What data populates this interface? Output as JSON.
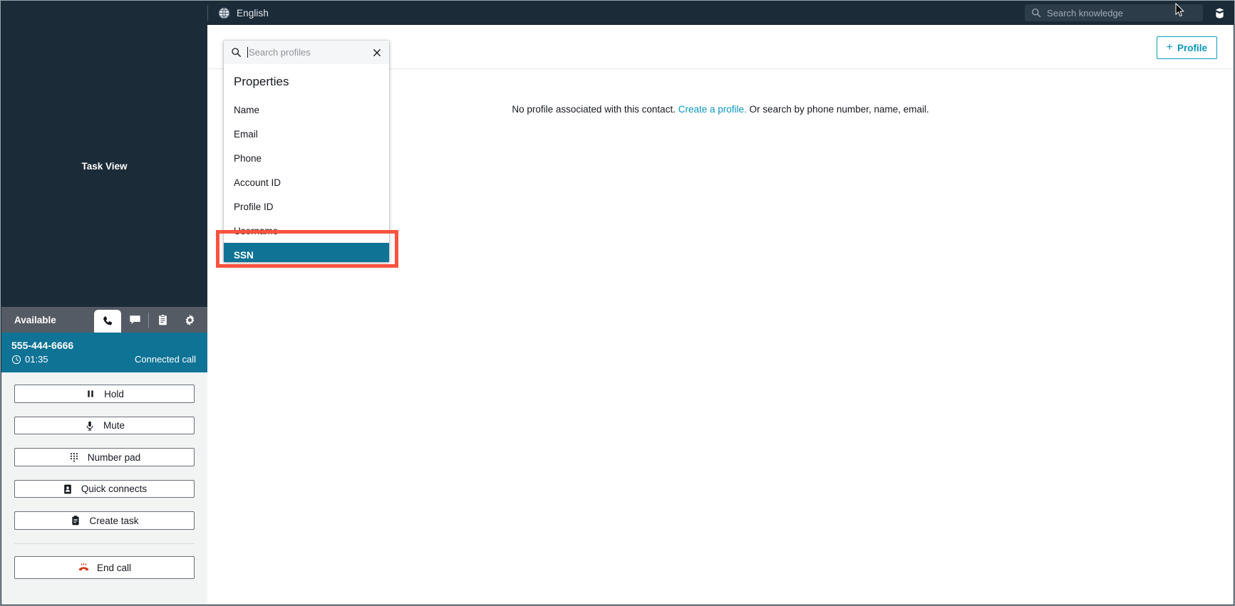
{
  "topbar": {
    "language_label": "English",
    "globe_icon": "globe-icon",
    "knowledge_search_placeholder": "Search knowledge",
    "knowledge_search_icon": "search-icon",
    "book_icon": "book-icon"
  },
  "ccp": {
    "task_view_label": "Task View",
    "agent_status": "Available",
    "tabs": [
      {
        "name": "phone",
        "icon": "phone-icon",
        "active": true
      },
      {
        "name": "chat",
        "icon": "chat-bubble-icon",
        "active": false
      },
      {
        "name": "tasks",
        "icon": "clipboard-icon",
        "active": false
      },
      {
        "name": "settings",
        "icon": "gear-icon",
        "active": false
      }
    ],
    "call": {
      "number": "555-444-6666",
      "timer": "01:35",
      "timer_icon": "clock-icon",
      "state": "Connected call",
      "accent_color": "#0f7396"
    },
    "controls": [
      {
        "label": "Hold",
        "icon": "pause-icon"
      },
      {
        "label": "Mute",
        "icon": "microphone-icon"
      },
      {
        "label": "Number pad",
        "icon": "dialpad-icon"
      },
      {
        "label": "Quick connects",
        "icon": "contact-card-icon"
      },
      {
        "label": "Create task",
        "icon": "clipboard-icon"
      }
    ],
    "end_call": {
      "label": "End call",
      "icon": "end-call-icon",
      "color": "#d13212"
    }
  },
  "main": {
    "profile_button": {
      "label": "Profile",
      "plus": "+",
      "color": "#0a97bd"
    },
    "empty_state": {
      "prefix": "No profile associated with this contact. ",
      "link": "Create a profile.",
      "suffix": " Or search by phone number, name, email."
    }
  },
  "profile_search": {
    "search_icon": "search-icon",
    "placeholder": "Search profiles",
    "value": "",
    "close_icon": "close-icon",
    "section_title": "Properties",
    "items": [
      {
        "label": "Name",
        "selected": false
      },
      {
        "label": "Email",
        "selected": false
      },
      {
        "label": "Phone",
        "selected": false
      },
      {
        "label": "Account ID",
        "selected": false
      },
      {
        "label": "Profile ID",
        "selected": false
      },
      {
        "label": "Username",
        "selected": false
      },
      {
        "label": "SSN",
        "selected": true
      }
    ],
    "selected_color": "#0f7396"
  },
  "annotation": {
    "color": "#f9533f",
    "target": "SSN"
  }
}
